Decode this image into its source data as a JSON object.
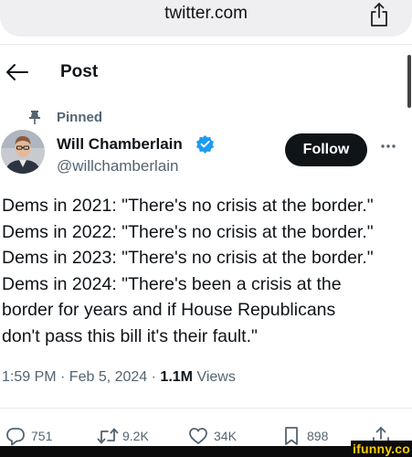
{
  "browser": {
    "url": "twitter.com",
    "share_icon": "share-icon"
  },
  "header": {
    "title": "Post",
    "back_icon": "arrow-left-icon"
  },
  "tweet": {
    "pinned_label": "Pinned",
    "author": {
      "name": "Will Chamberlain",
      "handle": "@willchamberlain",
      "verified": true,
      "verified_color": "#1d9bf0"
    },
    "follow_label": "Follow",
    "more_icon": "ellipsis-icon",
    "text_lines": [
      "Dems in 2021: \"There's no crisis at the border.\"",
      "Dems in 2022: \"There's no crisis at the border.\"",
      "Dems in 2023: \"There's no crisis at the border.\"",
      "Dems in 2024: \"There's been a crisis at the",
      "border for years and if House Republicans",
      "don't pass this bill it's their fault.\""
    ],
    "timestamp": "1:59 PM · Feb 5, 2024 · ",
    "views_count": "1.1M",
    "views_label": " Views",
    "stats": {
      "replies": "751",
      "reposts": "9.2K",
      "likes": "34K",
      "bookmarks": "898"
    }
  },
  "watermark": {
    "text": "ifunny.co",
    "color": "#ffcc00"
  }
}
